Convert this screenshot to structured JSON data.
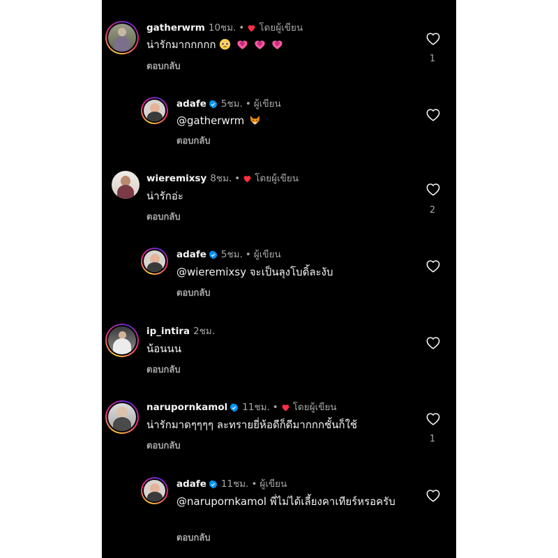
{
  "comments": [
    {
      "username": "gatherwrm",
      "verified": false,
      "time": "10ชม.",
      "separator": "•",
      "liked_by_author_label": "โดยผู้เขียน",
      "author_label": "",
      "text": "น่ารักมากกกกก",
      "emoji": [
        "pleading-face",
        "pink-heart",
        "pink-heart",
        "pink-heart"
      ],
      "reply_label": "ตอบกลับ",
      "like_count": "1"
    },
    {
      "username": "adafe",
      "verified": true,
      "time": "5ชม.",
      "separator": "•",
      "liked_by_author_label": "",
      "author_label": "ผู้เขียน",
      "text": "@gatherwrm",
      "emoji": [
        "fox-face"
      ],
      "reply_label": "ตอบกลับ",
      "like_count": ""
    },
    {
      "username": "wieremixsy",
      "verified": false,
      "time": "8ชม.",
      "separator": "•",
      "liked_by_author_label": "โดยผู้เขียน",
      "author_label": "",
      "text": "น่ารักอ่ะ",
      "emoji": [],
      "reply_label": "ตอบกลับ",
      "like_count": "2"
    },
    {
      "username": "adafe",
      "verified": true,
      "time": "5ชม.",
      "separator": "•",
      "liked_by_author_label": "",
      "author_label": "ผู้เขียน",
      "text": "@wieremixsy จะเป็นลุงโบดิ้ละงับ",
      "emoji": [],
      "reply_label": "ตอบกลับ",
      "like_count": ""
    },
    {
      "username": "ip_intira",
      "verified": false,
      "time": "2ชม.",
      "separator": "",
      "liked_by_author_label": "",
      "author_label": "",
      "text": "น้อนนน",
      "emoji": [],
      "reply_label": "ตอบกลับ",
      "like_count": ""
    },
    {
      "username": "narupornkamol",
      "verified": true,
      "time": "11ชม.",
      "separator": "•",
      "liked_by_author_label": "โดยผู้เขียน",
      "author_label": "",
      "text": "น่ารักมาดๆๆๆๆ ละทรายยี่ห้อดีก็ดีมากกกชั้นก็ใช้",
      "emoji": [],
      "reply_label": "ตอบกลับ",
      "like_count": "1"
    },
    {
      "username": "adafe",
      "verified": true,
      "time": "11ชม.",
      "separator": "•",
      "liked_by_author_label": "",
      "author_label": "ผู้เขียน",
      "text": "@narupornkamol พี่ไม่ได้เลี้ยงคาเทียร์หรอครับ",
      "emoji": [],
      "reply_label": "ตอบกลับ",
      "like_count": ""
    }
  ],
  "colors": {
    "background": "#000000",
    "text": "#f5f5f5",
    "secondary": "#a8a8a8",
    "heart_red": "#ff3040",
    "verified_blue": "#0095f6"
  }
}
